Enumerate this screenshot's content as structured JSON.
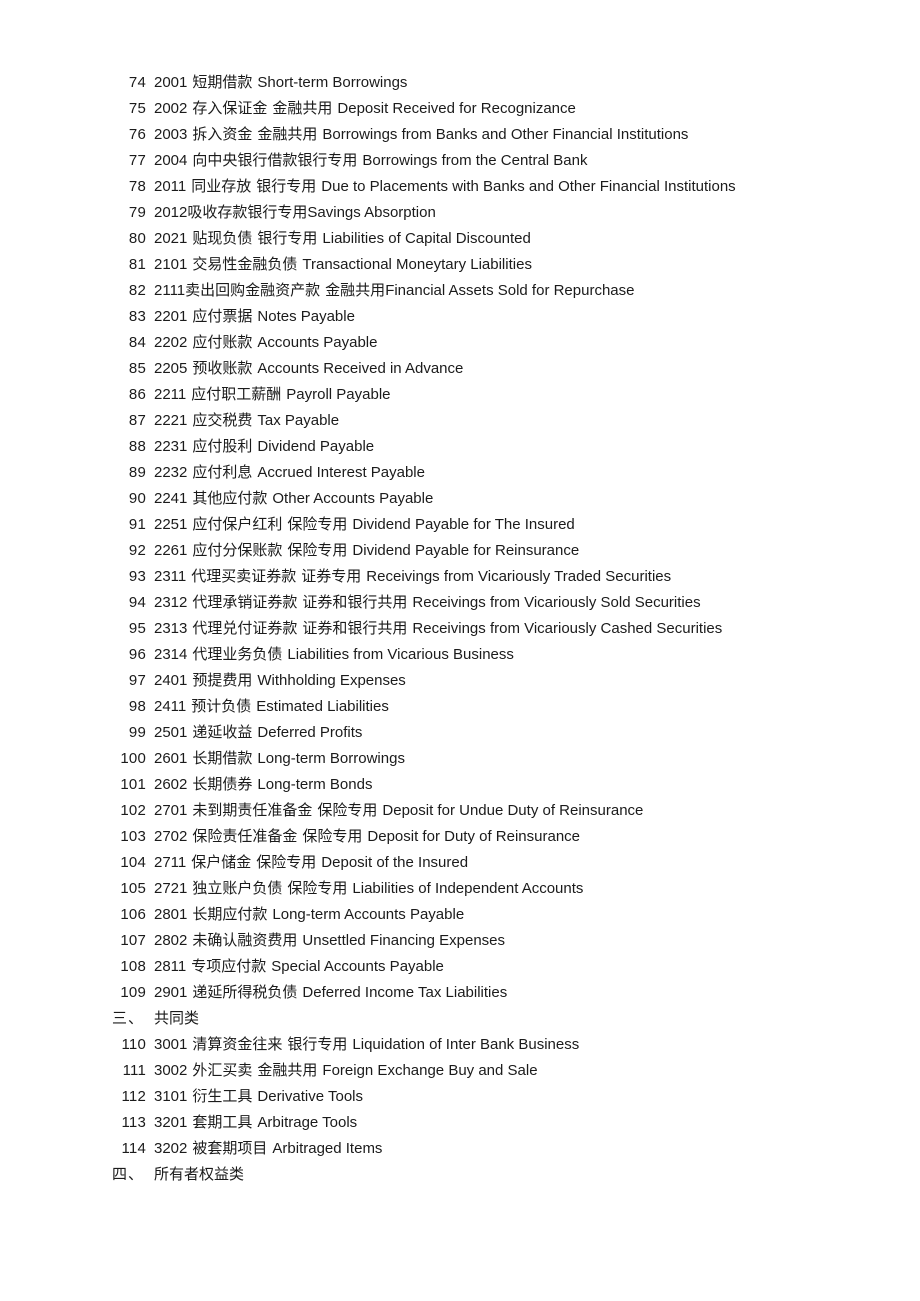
{
  "document": {
    "page_background": "#ffffff",
    "text_color": "#1b1b1b",
    "rows": [
      {
        "num": "74",
        "code": "2001",
        "cn": "短期借款",
        "sep1": " ",
        "note": "",
        "sep2": "",
        "en": "Short-term Borrowings"
      },
      {
        "num": "75",
        "code": "2002",
        "cn": "存入保证金",
        "sep1": " ",
        "note": "金融共用",
        "sep2": " ",
        "en": "Deposit Received for Recognizance"
      },
      {
        "num": "76",
        "code": "2003",
        "cn": "拆入资金",
        "sep1": " ",
        "note": "金融共用",
        "sep2": " ",
        "en": "Borrowings from Banks and Other Financial Institutions"
      },
      {
        "num": "77",
        "code": "2004",
        "cn": "向中央银行借款银行专用",
        "sep1": "",
        "note": "",
        "sep2": " ",
        "en": "Borrowings from the Central Bank"
      },
      {
        "num": "78",
        "code": "2011",
        "cn": "同业存放",
        "sep1": " ",
        "note": "银行专用",
        "sep2": " ",
        "en": "Due to Placements with Banks and Other Financial Institutions"
      },
      {
        "num": "79",
        "code": "2012",
        "cn": "吸收存款银行专用",
        "sep1": "",
        "note": "",
        "sep2": "",
        "en": "Savings Absorption",
        "tight_code": true
      },
      {
        "num": "80",
        "code": "2021",
        "cn": "贴现负债",
        "sep1": " ",
        "note": "银行专用",
        "sep2": " ",
        "en": "Liabilities of Capital Discounted"
      },
      {
        "num": "81",
        "code": "2101",
        "cn": "交易性金融负债",
        "sep1": " ",
        "note": "",
        "sep2": "",
        "en": "Transactional Moneytary Liabilities"
      },
      {
        "num": "82",
        "code": "2111",
        "cn": "卖出回购金融资产款",
        "sep1": " ",
        "note": "金融共用",
        "sep2": "",
        "en": "Financial Assets Sold for Repurchase",
        "tight_code": true
      },
      {
        "num": "83",
        "code": "2201",
        "cn": "应付票据",
        "sep1": " ",
        "note": "",
        "sep2": "",
        "en": "Notes Payable"
      },
      {
        "num": "84",
        "code": "2202",
        "cn": "应付账款",
        "sep1": " ",
        "note": "",
        "sep2": "",
        "en": "Accounts Payable"
      },
      {
        "num": "85",
        "code": "2205",
        "cn": "预收账款",
        "sep1": " ",
        "note": "",
        "sep2": "",
        "en": "Accounts Received in Advance"
      },
      {
        "num": "86",
        "code": "2211",
        "cn": "应付职工薪酬",
        "sep1": " ",
        "note": "",
        "sep2": "",
        "en": "Payroll Payable"
      },
      {
        "num": "87",
        "code": "2221",
        "cn": "应交税费",
        "sep1": " ",
        "note": "",
        "sep2": "",
        "en": "Tax Payable"
      },
      {
        "num": "88",
        "code": "2231",
        "cn": "应付股利",
        "sep1": " ",
        "note": "",
        "sep2": "",
        "en": "Dividend Payable"
      },
      {
        "num": "89",
        "code": "2232",
        "cn": "应付利息",
        "sep1": " ",
        "note": "",
        "sep2": "",
        "en": "Accrued Interest Payable"
      },
      {
        "num": "90",
        "code": "2241",
        "cn": "其他应付款",
        "sep1": " ",
        "note": "",
        "sep2": "",
        "en": "Other Accounts Payable"
      },
      {
        "num": "91",
        "code": "2251",
        "cn": "应付保户红利",
        "sep1": " ",
        "note": "保险专用",
        "sep2": " ",
        "en": "Dividend Payable for The Insured"
      },
      {
        "num": "92",
        "code": "2261",
        "cn": "应付分保账款",
        "sep1": " ",
        "note": "保险专用",
        "sep2": " ",
        "en": "Dividend Payable for Reinsurance"
      },
      {
        "num": "93",
        "code": "2311",
        "cn": "代理买卖证券款",
        "sep1": " ",
        "note": "证券专用",
        "sep2": " ",
        "en": "Receivings from Vicariously Traded Securities"
      },
      {
        "num": "94",
        "code": "2312",
        "cn": "代理承销证券款",
        "sep1": " ",
        "note": "证券和银行共用",
        "sep2": " ",
        "en": "Receivings from Vicariously Sold Securities"
      },
      {
        "num": "95",
        "code": "2313",
        "cn": "代理兑付证券款",
        "sep1": " ",
        "note": "证券和银行共用",
        "sep2": " ",
        "en": "Receivings from Vicariously Cashed Securities"
      },
      {
        "num": "96",
        "code": "2314",
        "cn": "代理业务负债",
        "sep1": " ",
        "note": "",
        "sep2": "",
        "en": "Liabilities from Vicarious Business"
      },
      {
        "num": "97",
        "code": "2401",
        "cn": "预提费用",
        "sep1": " ",
        "note": "",
        "sep2": "",
        "en": "Withholding Expenses"
      },
      {
        "num": "98",
        "code": "2411",
        "cn": "预计负债",
        "sep1": " ",
        "note": "",
        "sep2": "",
        "en": "Estimated Liabilities"
      },
      {
        "num": "99",
        "code": "2501",
        "cn": "递延收益",
        "sep1": " ",
        "note": "",
        "sep2": "",
        "en": "Deferred Profits"
      },
      {
        "num": "100",
        "code": "2601",
        "cn": "长期借款",
        "sep1": " ",
        "note": "",
        "sep2": "",
        "en": "Long-term Borrowings"
      },
      {
        "num": "101",
        "code": "2602",
        "cn": "长期债券",
        "sep1": " ",
        "note": "",
        "sep2": "",
        "en": "Long-term Bonds"
      },
      {
        "num": "102",
        "code": "2701",
        "cn": "未到期责任准备金",
        "sep1": " ",
        "note": "保险专用",
        "sep2": " ",
        "en": "Deposit for Undue Duty of Reinsurance"
      },
      {
        "num": "103",
        "code": "2702",
        "cn": "保险责任准备金",
        "sep1": " ",
        "note": "保险专用",
        "sep2": " ",
        "en": "Deposit for Duty of Reinsurance"
      },
      {
        "num": "104",
        "code": "2711",
        "cn": "保户储金",
        "sep1": " ",
        "note": "保险专用",
        "sep2": " ",
        "en": "Deposit of the Insured"
      },
      {
        "num": "105",
        "code": "2721",
        "cn": "独立账户负债",
        "sep1": " ",
        "note": "保险专用",
        "sep2": " ",
        "en": "Liabilities of Independent Accounts"
      },
      {
        "num": "106",
        "code": "2801",
        "cn": "长期应付款",
        "sep1": " ",
        "note": "",
        "sep2": "",
        "en": "Long-term Accounts Payable"
      },
      {
        "num": "107",
        "code": "2802",
        "cn": "未确认融资费用",
        "sep1": " ",
        "note": "",
        "sep2": "",
        "en": "Unsettled Financing Expenses"
      },
      {
        "num": "108",
        "code": "2811",
        "cn": "专项应付款",
        "sep1": " ",
        "note": "",
        "sep2": "",
        "en": "Special Accounts Payable"
      },
      {
        "num": "109",
        "code": "2901",
        "cn": "递延所得税负债",
        "sep1": " ",
        "note": "",
        "sep2": "",
        "en": "Deferred Income Tax Liabilities"
      }
    ],
    "section_three": {
      "num": "三、",
      "label": "共同类"
    },
    "rows_common": [
      {
        "num": "110",
        "code": "3001",
        "cn": "清算资金往来",
        "sep1": " ",
        "note": "银行专用",
        "sep2": " ",
        "en": "Liquidation of Inter Bank Business"
      },
      {
        "num": "111",
        "code": "3002",
        "cn": "外汇买卖",
        "sep1": " ",
        "note": "金融共用",
        "sep2": " ",
        "en": "Foreign Exchange Buy and Sale"
      },
      {
        "num": "112",
        "code": "3101",
        "cn": "衍生工具",
        "sep1": " ",
        "note": "",
        "sep2": "",
        "en": "Derivative Tools"
      },
      {
        "num": "113",
        "code": "3201",
        "cn": "套期工具",
        "sep1": " ",
        "note": "",
        "sep2": "",
        "en": "Arbitrage Tools"
      },
      {
        "num": "114",
        "code": "3202",
        "cn": "被套期项目",
        "sep1": " ",
        "note": "",
        "sep2": "",
        "en": "Arbitraged Items"
      }
    ],
    "section_four": {
      "num": "四、",
      "label": "所有者权益类"
    }
  }
}
